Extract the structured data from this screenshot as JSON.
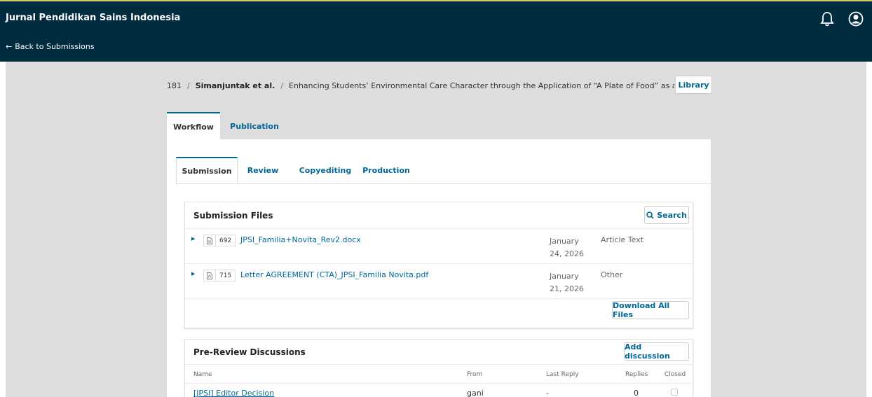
{
  "header": {
    "site_title": "Jurnal Pendidikan Sains Indonesia",
    "back_link": "Back to Submissions",
    "back_arrow": "←",
    "icons": [
      "bell-icon",
      "user-icon"
    ]
  },
  "breadcrumb": {
    "id": "181",
    "separator": "/",
    "authors": "Simanjuntak et al.",
    "title": "Enhancing Students’ Environmental Care Character through the Application of “A Plate of Food” as a Learni"
  },
  "library_label": "Library",
  "tabs": [
    {
      "label": "Workflow",
      "active": true
    },
    {
      "label": "Publication",
      "active": false
    }
  ],
  "subtabs": [
    {
      "label": "Submission",
      "active": true
    },
    {
      "label": "Review",
      "active": false
    },
    {
      "label": "Copyediting",
      "active": false
    },
    {
      "label": "Production",
      "active": false
    }
  ],
  "submission_files": {
    "title": "Submission Files",
    "search_label": "Search",
    "files": [
      {
        "id": "692",
        "name": "JPSI_Familia+Novita_Rev2.docx",
        "date_line1": "January",
        "date_line2": "24, 2026",
        "type": "Article Text"
      },
      {
        "id": "715",
        "name": "Letter AGREEMENT (CTA)_JPSI_Familia Novita.pdf",
        "date_line1": "January",
        "date_line2": "21, 2026",
        "type": "Other"
      }
    ],
    "download_all_label": "Download All Files"
  },
  "discussions": {
    "title": "Pre-Review Discussions",
    "add_label": "Add discussion",
    "columns": [
      "Name",
      "From",
      "Last Reply",
      "Replies",
      "Closed"
    ],
    "rows": [
      {
        "name": "[JPSI] Editor Decision",
        "from": "gani",
        "last_reply": "-",
        "replies": "0",
        "closed": false
      }
    ]
  },
  "colors": {
    "header_bg": "#002c40",
    "accent": "#006798",
    "page_bg": "#dddddd"
  }
}
